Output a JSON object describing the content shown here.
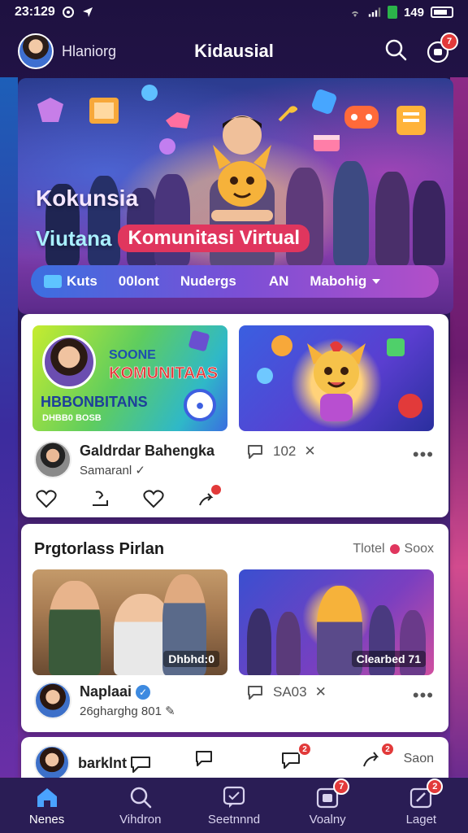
{
  "status_bar": {
    "time": "23:129",
    "battery": "149"
  },
  "header": {
    "username": "Hlaniorg",
    "app_title": "Kidausial",
    "notification_count": "7"
  },
  "hero": {
    "line1": "Kokunsia",
    "line2": "Viutana",
    "pill": "Komunitasi Virtual",
    "filters": [
      "Kuts",
      "00lont",
      "Nudergs",
      "AN",
      "Mabohig"
    ]
  },
  "card1": {
    "thumb_a_line1": "SOONE",
    "thumb_a_line2": "KOMUNITAAS",
    "thumb_a_line3": "HBBONBITANS",
    "thumb_a_line4": "DHBB0 BOSB",
    "author": "Galdrdar Bahengka",
    "subtitle": "Samaranl",
    "comments": "102",
    "share_badge": ""
  },
  "card2": {
    "section_title": "Prgtorlass Pirlan",
    "section_right": "Tlotel",
    "section_right2": "Soox",
    "thumb_c_label": "Dhbhd:0",
    "thumb_d_label": "Clearbed 71",
    "author": "Naplaai",
    "subtitle": "26gharghg 801",
    "comments": "SA03"
  },
  "card3": {
    "author": "barklnt",
    "save_label": "Saon",
    "badge1": "2",
    "badge2": "2"
  },
  "bottom_nav": {
    "items": [
      {
        "label": "Nenes",
        "icon": "home-icon",
        "active": true
      },
      {
        "label": "Vihdron",
        "icon": "search-icon",
        "active": false
      },
      {
        "label": "Seetnnnd",
        "icon": "chat-icon",
        "active": false
      },
      {
        "label": "Voalny",
        "icon": "calendar-icon",
        "active": false,
        "badge": "7"
      },
      {
        "label": "Laget",
        "icon": "edit-icon",
        "active": false,
        "badge": "2"
      }
    ]
  },
  "colors": {
    "accent_pink": "#e0365e",
    "nav_bg": "#2a1d55",
    "badge_red": "#e23a3a"
  }
}
